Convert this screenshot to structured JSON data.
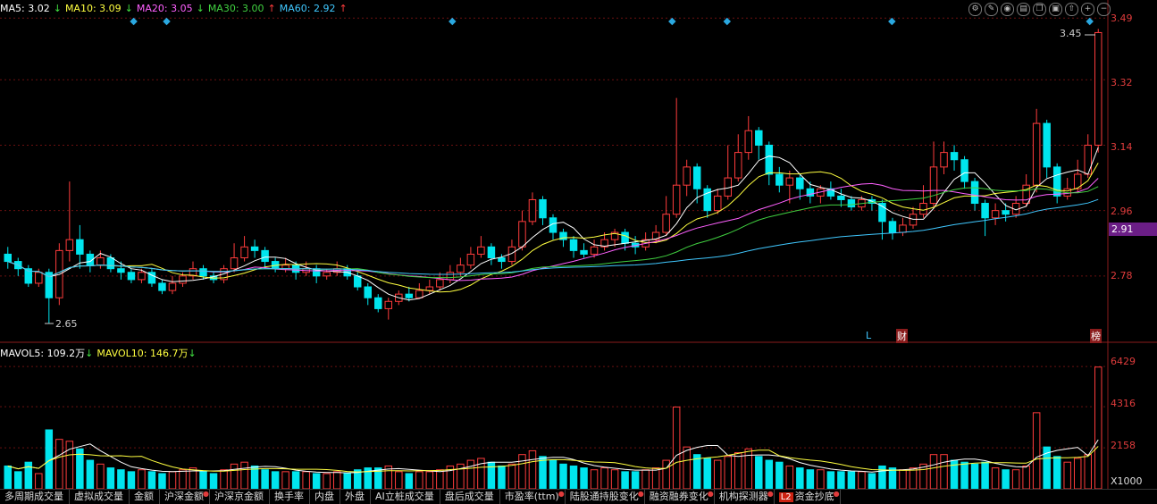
{
  "ma_legend": [
    {
      "label": "MA5: 3.02",
      "arrow": "↓",
      "color": "#ffffff"
    },
    {
      "label": "MA10: 3.09",
      "arrow": "↓",
      "color": "#ffff40"
    },
    {
      "label": "MA20: 3.05",
      "arrow": "↓",
      "color": "#ff60ff"
    },
    {
      "label": "MA30: 3.00",
      "arrow": "↑",
      "color": "#40d040"
    },
    {
      "label": "MA60: 2.92",
      "arrow": "↑",
      "color": "#40c8ff"
    }
  ],
  "vol_legend": [
    {
      "label": "MAVOL5: 109.2万",
      "arrow": "↓",
      "color": "#ffffff"
    },
    {
      "label": "MAVOL10: 146.7万",
      "arrow": "↓",
      "color": "#ffff40"
    }
  ],
  "toolbar_icons": [
    "settings-icon",
    "brush-icon",
    "eye-icon",
    "cart-icon",
    "copy-icon",
    "lock-icon",
    "export-icon",
    "zoom-in-icon",
    "zoom-out-icon"
  ],
  "price_axis": [
    "3.49",
    "3.32",
    "3.14",
    "2.96",
    "2.78"
  ],
  "current_price": "2.91",
  "high_label": "3.45",
  "low_label": "2.65",
  "volume_axis": [
    "6429",
    "4316",
    "2158",
    "X1000"
  ],
  "markers": {
    "L": "L",
    "cai": "财",
    "bang": "榜"
  },
  "tabs": [
    {
      "label": "多周期成交量",
      "dot": false
    },
    {
      "label": "虚拟成交量",
      "dot": false
    },
    {
      "label": "金额",
      "dot": false
    },
    {
      "label": "沪深金额",
      "dot": true
    },
    {
      "label": "沪深京金额",
      "dot": false
    },
    {
      "label": "换手率",
      "dot": false
    },
    {
      "label": "内盘",
      "dot": false
    },
    {
      "label": "外盘",
      "dot": false
    },
    {
      "label": "AI立桩成交量",
      "dot": false
    },
    {
      "label": "盘后成交量",
      "dot": false
    },
    {
      "label": "市盈率(ttm)",
      "dot": true
    },
    {
      "label": "陆股通持股变化",
      "dot": true
    },
    {
      "label": "融资融券变化",
      "dot": true
    },
    {
      "label": "机构探测器",
      "dot": true
    },
    {
      "label": "资金抄底",
      "dot": true,
      "l2": "L2"
    }
  ],
  "chart_data": {
    "type": "candlestick",
    "ylim": [
      2.6,
      3.52
    ],
    "vol_ylim": [
      0,
      7000
    ],
    "colors": {
      "up": "#ff3c3c",
      "down": "#00e5ee"
    },
    "candles": [
      [
        2.84,
        2.82,
        2.86,
        2.8,
        1200
      ],
      [
        2.82,
        2.8,
        2.83,
        2.78,
        900
      ],
      [
        2.8,
        2.76,
        2.81,
        2.75,
        1400
      ],
      [
        2.76,
        2.79,
        2.8,
        2.75,
        800
      ],
      [
        2.79,
        2.72,
        2.8,
        2.65,
        3100
      ],
      [
        2.72,
        2.85,
        2.87,
        2.7,
        2600
      ],
      [
        2.85,
        2.88,
        3.04,
        2.82,
        2500
      ],
      [
        2.88,
        2.84,
        2.92,
        2.8,
        2100
      ],
      [
        2.84,
        2.81,
        2.85,
        2.79,
        1500
      ],
      [
        2.81,
        2.83,
        2.85,
        2.8,
        1300
      ],
      [
        2.83,
        2.8,
        2.84,
        2.79,
        1100
      ],
      [
        2.8,
        2.79,
        2.82,
        2.77,
        1000
      ],
      [
        2.79,
        2.77,
        2.8,
        2.76,
        900
      ],
      [
        2.77,
        2.79,
        2.8,
        2.76,
        1000
      ],
      [
        2.79,
        2.76,
        2.8,
        2.75,
        900
      ],
      [
        2.76,
        2.74,
        2.77,
        2.73,
        800
      ],
      [
        2.74,
        2.76,
        2.78,
        2.73,
        900
      ],
      [
        2.76,
        2.78,
        2.79,
        2.75,
        1000
      ],
      [
        2.78,
        2.8,
        2.82,
        2.77,
        1100
      ],
      [
        2.8,
        2.78,
        2.81,
        2.77,
        900
      ],
      [
        2.78,
        2.77,
        2.79,
        2.76,
        800
      ],
      [
        2.77,
        2.8,
        2.81,
        2.76,
        1000
      ],
      [
        2.8,
        2.83,
        2.87,
        2.79,
        1300
      ],
      [
        2.83,
        2.86,
        2.89,
        2.82,
        1400
      ],
      [
        2.86,
        2.85,
        2.88,
        2.83,
        1200
      ],
      [
        2.85,
        2.82,
        2.86,
        2.8,
        1000
      ],
      [
        2.82,
        2.8,
        2.83,
        2.79,
        900
      ],
      [
        2.8,
        2.81,
        2.83,
        2.79,
        900
      ],
      [
        2.81,
        2.79,
        2.82,
        2.77,
        900
      ],
      [
        2.79,
        2.8,
        2.82,
        2.78,
        900
      ],
      [
        2.8,
        2.78,
        2.81,
        2.76,
        800
      ],
      [
        2.78,
        2.79,
        2.8,
        2.77,
        800
      ],
      [
        2.79,
        2.8,
        2.82,
        2.78,
        900
      ],
      [
        2.8,
        2.78,
        2.81,
        2.77,
        800
      ],
      [
        2.78,
        2.75,
        2.79,
        2.74,
        1000
      ],
      [
        2.75,
        2.72,
        2.76,
        2.7,
        1100
      ],
      [
        2.72,
        2.69,
        2.73,
        2.68,
        1100
      ],
      [
        2.69,
        2.71,
        2.72,
        2.66,
        1200
      ],
      [
        2.71,
        2.73,
        2.74,
        2.7,
        900
      ],
      [
        2.73,
        2.72,
        2.75,
        2.71,
        800
      ],
      [
        2.72,
        2.74,
        2.76,
        2.72,
        900
      ],
      [
        2.74,
        2.75,
        2.77,
        2.73,
        900
      ],
      [
        2.75,
        2.77,
        2.79,
        2.74,
        1000
      ],
      [
        2.77,
        2.79,
        2.81,
        2.76,
        1200
      ],
      [
        2.79,
        2.81,
        2.83,
        2.78,
        1300
      ],
      [
        2.81,
        2.84,
        2.86,
        2.8,
        1500
      ],
      [
        2.84,
        2.86,
        2.89,
        2.83,
        1600
      ],
      [
        2.86,
        2.83,
        2.87,
        2.81,
        1400
      ],
      [
        2.83,
        2.82,
        2.84,
        2.8,
        1200
      ],
      [
        2.82,
        2.86,
        2.88,
        2.81,
        1300
      ],
      [
        2.86,
        2.93,
        2.96,
        2.85,
        1800
      ],
      [
        2.93,
        2.99,
        3.01,
        2.92,
        2000
      ],
      [
        2.99,
        2.94,
        3.0,
        2.92,
        1700
      ],
      [
        2.94,
        2.9,
        2.95,
        2.88,
        1500
      ],
      [
        2.9,
        2.88,
        2.91,
        2.86,
        1300
      ],
      [
        2.88,
        2.85,
        2.89,
        2.83,
        1200
      ],
      [
        2.85,
        2.84,
        2.87,
        2.83,
        1100
      ],
      [
        2.84,
        2.86,
        2.88,
        2.83,
        1000
      ],
      [
        2.86,
        2.88,
        2.9,
        2.85,
        1100
      ],
      [
        2.88,
        2.9,
        2.91,
        2.86,
        1000
      ],
      [
        2.9,
        2.87,
        2.91,
        2.85,
        900
      ],
      [
        2.87,
        2.86,
        2.89,
        2.84,
        900
      ],
      [
        2.86,
        2.88,
        2.9,
        2.85,
        1000
      ],
      [
        2.88,
        2.9,
        2.92,
        2.87,
        1100
      ],
      [
        2.9,
        2.95,
        3.0,
        2.89,
        1500
      ],
      [
        2.95,
        3.03,
        3.27,
        2.94,
        4300
      ],
      [
        3.03,
        3.08,
        3.1,
        3.0,
        2200
      ],
      [
        3.08,
        3.02,
        3.09,
        2.98,
        1800
      ],
      [
        3.02,
        2.96,
        3.03,
        2.94,
        1600
      ],
      [
        2.96,
        3.0,
        3.02,
        2.95,
        1500
      ],
      [
        3.0,
        3.05,
        3.14,
        2.99,
        1700
      ],
      [
        3.05,
        3.12,
        3.17,
        3.04,
        1900
      ],
      [
        3.12,
        3.18,
        3.22,
        3.1,
        2100
      ],
      [
        3.18,
        3.14,
        3.19,
        3.1,
        1700
      ],
      [
        3.14,
        3.06,
        3.15,
        3.03,
        1500
      ],
      [
        3.06,
        3.03,
        3.08,
        3.01,
        1400
      ],
      [
        3.03,
        3.05,
        3.07,
        2.98,
        1200
      ],
      [
        3.05,
        3.02,
        3.06,
        2.99,
        1100
      ],
      [
        3.02,
        3.0,
        3.04,
        2.98,
        1000
      ],
      [
        3.0,
        3.02,
        3.03,
        2.98,
        1000
      ],
      [
        3.02,
        3.0,
        3.04,
        2.99,
        900
      ],
      [
        3.0,
        2.99,
        3.02,
        2.97,
        900
      ],
      [
        2.99,
        2.97,
        3.0,
        2.96,
        900
      ],
      [
        2.97,
        2.99,
        3.0,
        2.96,
        900
      ],
      [
        2.99,
        2.98,
        3.0,
        2.96,
        800
      ],
      [
        2.98,
        2.93,
        2.99,
        2.88,
        1200
      ],
      [
        2.93,
        2.9,
        2.94,
        2.88,
        1100
      ],
      [
        2.9,
        2.92,
        2.94,
        2.89,
        1000
      ],
      [
        2.92,
        2.95,
        2.97,
        2.91,
        1100
      ],
      [
        2.95,
        2.98,
        3.03,
        2.94,
        1300
      ],
      [
        2.98,
        3.08,
        3.15,
        2.97,
        1800
      ],
      [
        3.08,
        3.12,
        3.15,
        3.06,
        1800
      ],
      [
        3.12,
        3.1,
        3.14,
        3.07,
        1500
      ],
      [
        3.1,
        3.04,
        3.11,
        3.02,
        1400
      ],
      [
        3.04,
        2.98,
        3.05,
        2.96,
        1300
      ],
      [
        2.98,
        2.94,
        2.99,
        2.89,
        1400
      ],
      [
        2.94,
        2.96,
        2.98,
        2.92,
        1100
      ],
      [
        2.96,
        2.95,
        2.98,
        2.93,
        1000
      ],
      [
        2.95,
        2.98,
        3.0,
        2.94,
        1000
      ],
      [
        2.98,
        3.03,
        3.06,
        2.97,
        1200
      ],
      [
        3.03,
        3.2,
        3.24,
        3.01,
        4000
      ],
      [
        3.2,
        3.08,
        3.21,
        3.05,
        2200
      ],
      [
        3.08,
        3.0,
        3.09,
        2.98,
        1700
      ],
      [
        3.0,
        3.02,
        3.05,
        2.99,
        1400
      ],
      [
        3.02,
        3.06,
        3.1,
        3.01,
        1600
      ],
      [
        3.06,
        3.14,
        3.17,
        3.05,
        1800
      ],
      [
        3.14,
        3.45,
        3.46,
        3.12,
        6400
      ]
    ]
  }
}
